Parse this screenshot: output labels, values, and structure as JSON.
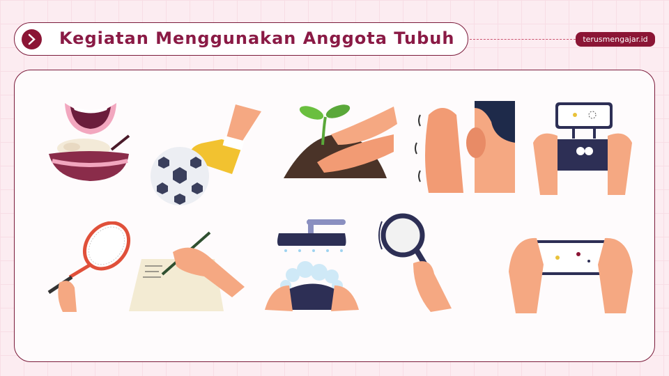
{
  "header": {
    "title": "Kegiatan Menggunakan Anggota Tubuh",
    "icon": "chevron-right-icon"
  },
  "badge": {
    "label": "terusmengajar.id"
  },
  "colors": {
    "accent": "#8b1535",
    "background": "#fcecf1",
    "skin": "#f5a882"
  },
  "illustrations": [
    "eating-icon",
    "kicking-ball-icon",
    "planting-icon",
    "listening-icon",
    "game-controller-icon",
    "tennis-racket-icon",
    "writing-icon",
    "washing-hands-icon",
    "magnifying-glass-icon",
    "mobile-game-icon"
  ]
}
